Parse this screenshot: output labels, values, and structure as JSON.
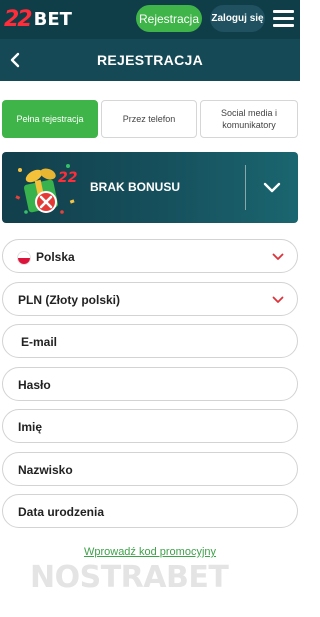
{
  "header": {
    "logo_number": "22",
    "logo_text": "BET",
    "register_label": "Rejestracja",
    "login_label": "Zaloguj się"
  },
  "titlebar": {
    "title": "REJESTRACJA"
  },
  "tabs": [
    {
      "label": "Pełna rejestracja",
      "active": true
    },
    {
      "label": "Przez telefon",
      "active": false
    },
    {
      "label": "Social media i komunikatory",
      "active": false
    }
  ],
  "bonus": {
    "label": "BRAK BONUSU"
  },
  "form": {
    "country": "Polska",
    "currency": "PLN (Złoty polski)",
    "email": "E-mail",
    "password": "Hasło",
    "first_name": "Imię",
    "last_name": "Nazwisko",
    "birth_date": "Data urodzenia"
  },
  "promo_link": "Wprowadź kod promocyjny",
  "watermark": "NOSTRABET",
  "colors": {
    "header_bg": "#0f3d48",
    "titlebar_bg": "#164956",
    "accent_green": "#3fb449",
    "chevron_red": "#e0323c"
  }
}
